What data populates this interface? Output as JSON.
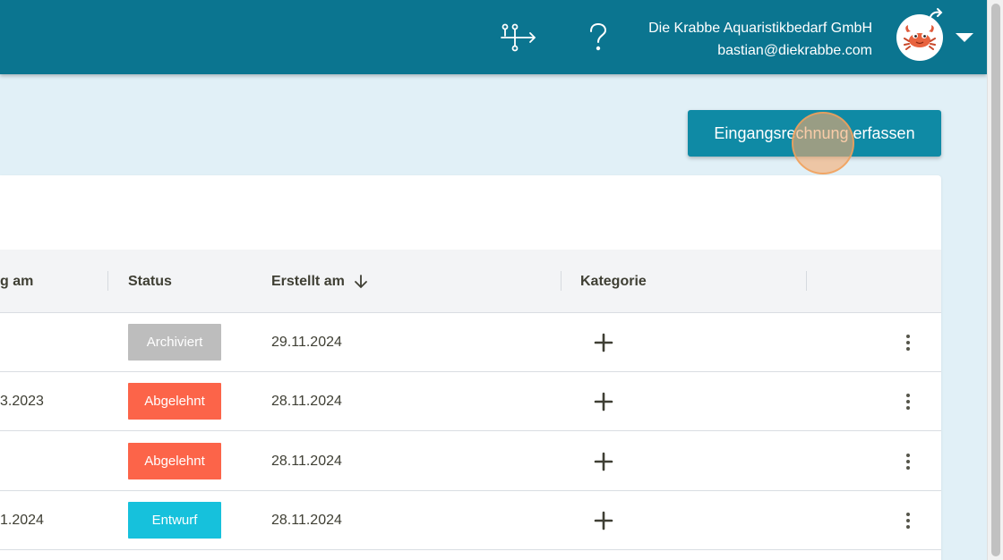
{
  "header": {
    "company_name": "Die Krabbe Aquaristikbedarf GmbH",
    "user_email": "bastian@diekrabbe.com",
    "icons": [
      "workflow-icon",
      "help-icon",
      "avatar-crab",
      "refresh-icon",
      "chevron-down-icon"
    ]
  },
  "toolbar": {
    "primary_button_label": "Eingangsrechnung erfassen"
  },
  "table": {
    "columns": {
      "date_partial": "g am",
      "status": "Status",
      "created": "Erstellt am",
      "category": "Kategorie"
    },
    "sort_icon": "arrow-down-icon",
    "rows": [
      {
        "date_partial": "",
        "status": "Archiviert",
        "created": "29.11.2024"
      },
      {
        "date_partial": "3.2023",
        "status": "Abgelehnt",
        "created": "28.11.2024"
      },
      {
        "date_partial": "",
        "status": "Abgelehnt",
        "created": "28.11.2024"
      },
      {
        "date_partial": "1.2024",
        "status": "Entwurf",
        "created": "28.11.2024"
      }
    ]
  },
  "colors": {
    "topbar": "#0b7590",
    "primary": "#0f8aa5",
    "background": "#e1f0f7",
    "status_archiviert": "#bdbdbd",
    "status_abgelehnt": "#fc6449",
    "status_entwurf": "#16c1dc"
  }
}
